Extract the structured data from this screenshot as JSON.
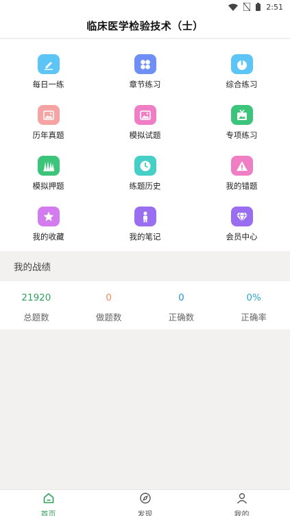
{
  "status_bar": {
    "time": "2:51",
    "icons": [
      "wifi-icon",
      "no-sim-icon",
      "battery-icon"
    ]
  },
  "header": {
    "title": "临床医学检验技术（士）"
  },
  "menu": [
    {
      "label": "每日一练",
      "icon": "pencil-icon",
      "color": "#5cc5f5"
    },
    {
      "label": "章节练习",
      "icon": "grid-four-icon",
      "color": "#6f8ff7"
    },
    {
      "label": "综合练习",
      "icon": "power-icon",
      "color": "#5cc5f5"
    },
    {
      "label": "历年真题",
      "icon": "picture-icon",
      "color": "#f6a3a3"
    },
    {
      "label": "模拟试题",
      "icon": "picture-icon",
      "color": "#f07ec5"
    },
    {
      "label": "专项练习",
      "icon": "tv-icon",
      "color": "#3cc47a"
    },
    {
      "label": "模拟押题",
      "icon": "forest-icon",
      "color": "#3cc47a"
    },
    {
      "label": "练题历史",
      "icon": "clock-icon",
      "color": "#45cfc6"
    },
    {
      "label": "我的错题",
      "icon": "warning-icon",
      "color": "#f07ec5"
    },
    {
      "label": "我的收藏",
      "icon": "star-icon",
      "color": "#d27cf0"
    },
    {
      "label": "我的笔记",
      "icon": "person-icon",
      "color": "#9a6ef0"
    },
    {
      "label": "会员中心",
      "icon": "diamond-icon",
      "color": "#9a6ef0"
    }
  ],
  "section": {
    "title": "我的战绩"
  },
  "stats": [
    {
      "value": "21920",
      "label": "总题数",
      "color": "#2e9e5b"
    },
    {
      "value": "0",
      "label": "做题数",
      "color": "#f08a5d"
    },
    {
      "value": "0",
      "label": "正确数",
      "color": "#2f8fd6"
    },
    {
      "value": "0%",
      "label": "正确率",
      "color": "#2aa6c9"
    }
  ],
  "bottom_nav": [
    {
      "label": "首页",
      "icon": "home-icon",
      "active": true
    },
    {
      "label": "发现",
      "icon": "compass-icon",
      "active": false
    },
    {
      "label": "我的",
      "icon": "user-icon",
      "active": false
    }
  ],
  "colors": {
    "accent": "#2e9e5b",
    "page_bg": "#f2f1ef"
  }
}
